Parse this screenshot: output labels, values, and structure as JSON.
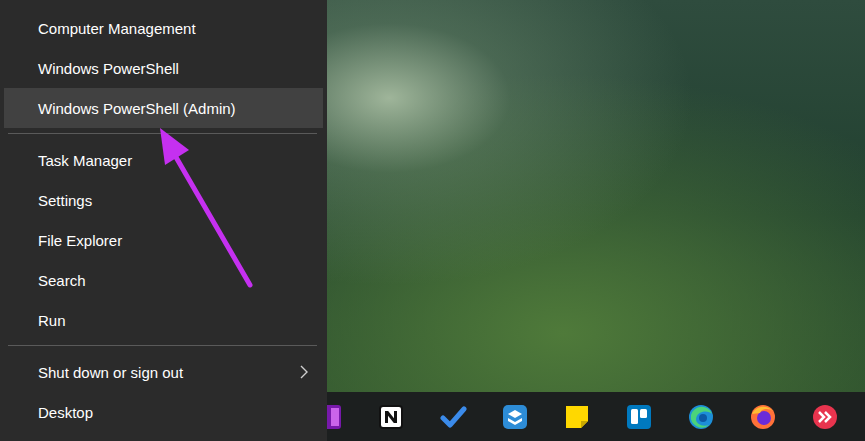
{
  "menu": {
    "groups": [
      {
        "items": [
          {
            "label": "Computer Management",
            "selected": false,
            "has_submenu": false
          },
          {
            "label": "Windows PowerShell",
            "selected": false,
            "has_submenu": false
          },
          {
            "label": "Windows PowerShell (Admin)",
            "selected": true,
            "has_submenu": false
          }
        ]
      },
      {
        "items": [
          {
            "label": "Task Manager",
            "selected": false,
            "has_submenu": false
          },
          {
            "label": "Settings",
            "selected": false,
            "has_submenu": false
          },
          {
            "label": "File Explorer",
            "selected": false,
            "has_submenu": false
          },
          {
            "label": "Search",
            "selected": false,
            "has_submenu": false
          },
          {
            "label": "Run",
            "selected": false,
            "has_submenu": false
          }
        ]
      },
      {
        "items": [
          {
            "label": "Shut down or sign out",
            "selected": false,
            "has_submenu": true
          },
          {
            "label": "Desktop",
            "selected": false,
            "has_submenu": false
          }
        ]
      }
    ]
  }
}
